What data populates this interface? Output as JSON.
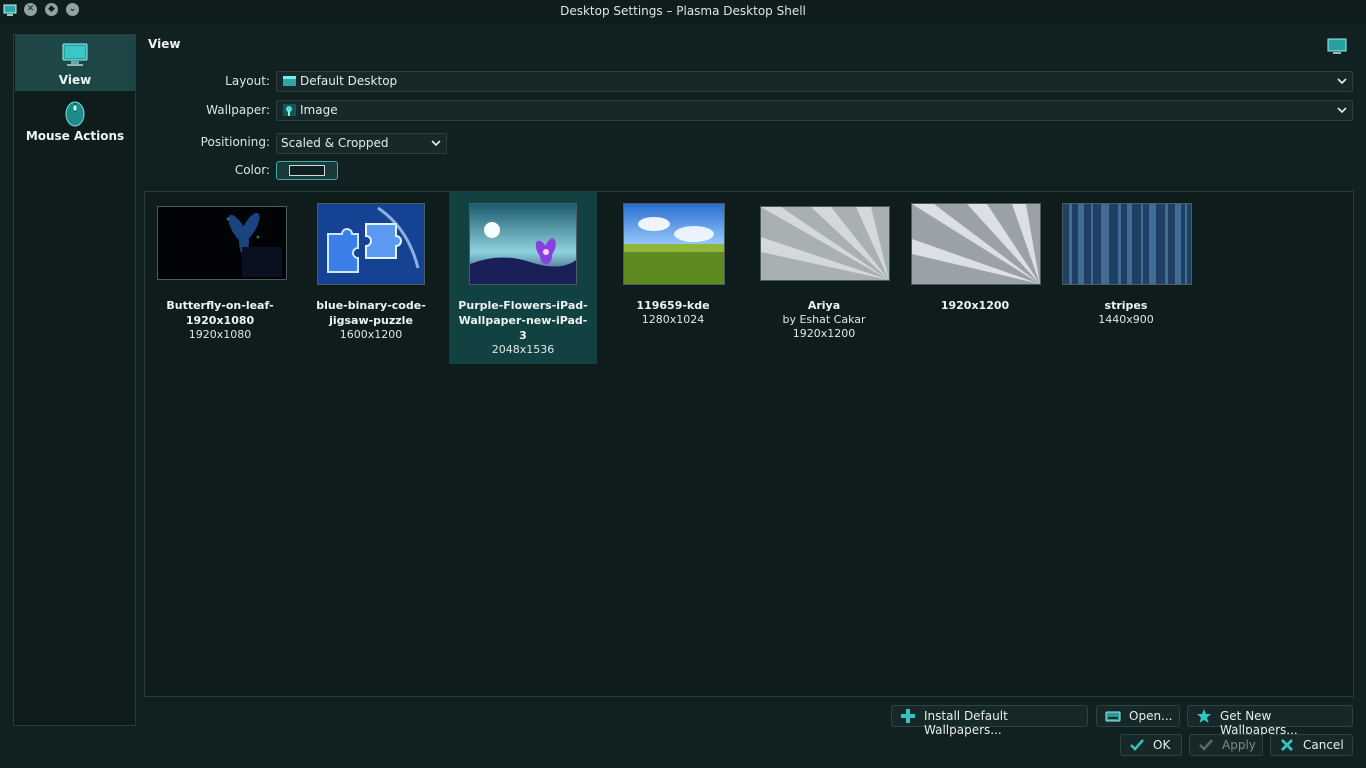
{
  "window": {
    "title": "Desktop Settings – Plasma Desktop Shell"
  },
  "sidebar": {
    "items": [
      {
        "label": "View",
        "icon": "monitor-icon"
      },
      {
        "label": "Mouse Actions",
        "icon": "mouse-icon"
      }
    ]
  },
  "page": {
    "title": "View"
  },
  "form": {
    "layout_label": "Layout:",
    "layout_value": "Default Desktop",
    "wallpaper_label": "Wallpaper:",
    "wallpaper_value": "Image",
    "positioning_label": "Positioning:",
    "positioning_value": "Scaled & Cropped",
    "color_label": "Color:",
    "color_value": "#102020"
  },
  "wallpapers": [
    {
      "name": "Butterfly-on-leaf-1920x1080",
      "author": "",
      "size": "1920x1080"
    },
    {
      "name": "blue-binary-code-jigsaw-puzzle",
      "author": "",
      "size": "1600x1200"
    },
    {
      "name": "Purple-Flowers-iPad-Wallpaper-new-iPad-3",
      "author": "",
      "size": "2048x1536",
      "selected": true
    },
    {
      "name": "119659-kde",
      "author": "",
      "size": "1280x1024"
    },
    {
      "name": "Ariya",
      "author": "by Eshat Cakar",
      "size": "1920x1200"
    },
    {
      "name": "1920x1200",
      "author": "",
      "size": ""
    },
    {
      "name": "stripes",
      "author": "",
      "size": "1440x900"
    }
  ],
  "actions": {
    "install_default": "Install Default Wallpapers...",
    "open": "Open...",
    "get_new": "Get New Wallpapers...",
    "ok": "OK",
    "apply": "Apply",
    "cancel": "Cancel"
  },
  "colors": {
    "accent": "#3fb9b9",
    "selection": "#124141",
    "background": "#112020"
  }
}
